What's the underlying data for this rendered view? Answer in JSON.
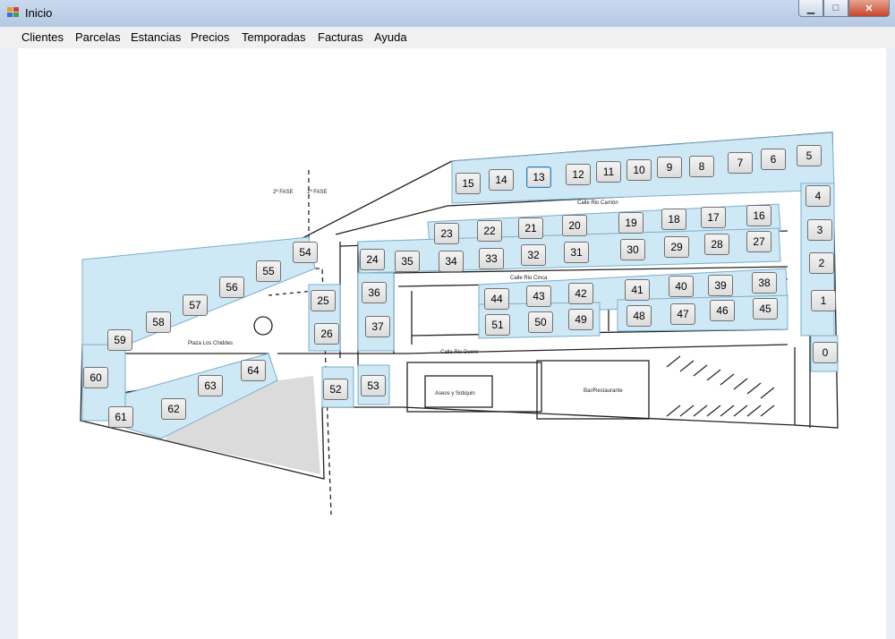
{
  "window": {
    "title": "Inicio",
    "min_icon": "minimize-icon",
    "max_icon": "maximize-icon",
    "close_icon": "close-icon"
  },
  "menu": [
    "Clientes",
    "Parcelas",
    "Estancias",
    "Precios",
    "Temporadas",
    "Facturas",
    "Ayuda"
  ],
  "map_labels": {
    "fase2": "2ª FASE",
    "fase1": "1ª FASE",
    "calle_top": "Calle Rio Carrión",
    "calle_mid": "Calle Rio Cinca",
    "calle_low": "Calle Rio Duero",
    "plaza": "Plaza Los Chiddes",
    "aseos": "Aseos y Sotiquin",
    "bar": "Bar/Restaurante"
  },
  "colors": {
    "plot_fill": "#cfe8f5",
    "plot_stroke": "#7aaecb",
    "selected": "#3c7fb1"
  },
  "plots": [
    "15",
    "14",
    "13",
    "12",
    "11",
    "10",
    "9",
    "8",
    "7",
    "6",
    "5",
    "4",
    "3",
    "2",
    "1",
    "0",
    "23",
    "22",
    "21",
    "20",
    "19",
    "18",
    "17",
    "16",
    "24",
    "35",
    "34",
    "33",
    "32",
    "31",
    "30",
    "29",
    "28",
    "27",
    "36",
    "25",
    "26",
    "37",
    "44",
    "43",
    "42",
    "41",
    "40",
    "39",
    "38",
    "51",
    "50",
    "49",
    "48",
    "47",
    "46",
    "45",
    "52",
    "53",
    "54",
    "55",
    "56",
    "57",
    "58",
    "59",
    "60",
    "61",
    "62",
    "63",
    "64"
  ]
}
